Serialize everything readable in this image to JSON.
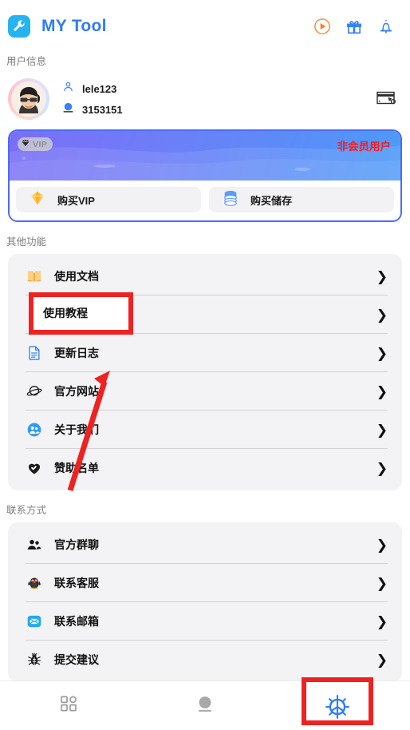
{
  "header": {
    "app_title": "MY Tool",
    "logo_icon": "wrench-icon",
    "icons": [
      {
        "name": "play-circle-icon",
        "color": "#ff7a22"
      },
      {
        "name": "gift-icon",
        "color": "#2f7cf6"
      },
      {
        "name": "bell-icon",
        "color": "#2f7cf6"
      }
    ]
  },
  "user_section": {
    "label": "用户信息",
    "avatar_name": "avatar",
    "username": "lele123",
    "user_id": "3153151",
    "username_icon": "person-icon",
    "userid_icon": "circle-icon",
    "card_icon": "card-settings-icon"
  },
  "vip": {
    "badge_label": "VIP",
    "badge_icon": "diamond-icon",
    "status_text": "非会员用户",
    "status_color": "#ff1a1a",
    "gradient_from": "#7b6ef6",
    "gradient_to": "#4d9bf8",
    "border_color": "#4a6cf7",
    "actions": [
      {
        "label": "购买VIP",
        "icon": "gem-icon"
      },
      {
        "label": "购买储存",
        "icon": "database-icon"
      }
    ]
  },
  "other_features": {
    "label": "其他功能",
    "items": [
      {
        "label": "使用文档",
        "icon": "book-icon"
      },
      {
        "label": "使用教程",
        "icon": "video-tutorial-icon"
      },
      {
        "label": "更新日志",
        "icon": "document-icon"
      },
      {
        "label": "官方网站",
        "icon": "planet-icon"
      },
      {
        "label": "关于我们",
        "icon": "people-icon"
      },
      {
        "label": "赞助名单",
        "icon": "heart-icon"
      }
    ]
  },
  "contact": {
    "label": "联系方式",
    "items": [
      {
        "label": "官方群聊",
        "icon": "group-chat-icon"
      },
      {
        "label": "联系客服",
        "icon": "penguin-support-icon"
      },
      {
        "label": "联系邮箱",
        "icon": "mail-icon"
      },
      {
        "label": "提交建议",
        "icon": "bug-icon"
      }
    ]
  },
  "bottom_nav": {
    "items": [
      {
        "name": "grid",
        "icon": "grid-icon",
        "active": false
      },
      {
        "name": "sphere",
        "icon": "sphere-icon",
        "active": false
      },
      {
        "name": "settings",
        "icon": "gear-icon",
        "active": true
      }
    ],
    "active_color": "#2f7cf6",
    "inactive_color": "#9b9b9b"
  },
  "annotations": {
    "highlight_color": "#ef2222",
    "boxes": [
      {
        "name": "tutorial-highlight",
        "target": "使用教程"
      },
      {
        "name": "settings-tab-highlight",
        "target": "gear-icon"
      }
    ],
    "arrow": {
      "name": "pointer-arrow",
      "points_to": "使用教程"
    }
  },
  "chevron_glyph": "❯"
}
